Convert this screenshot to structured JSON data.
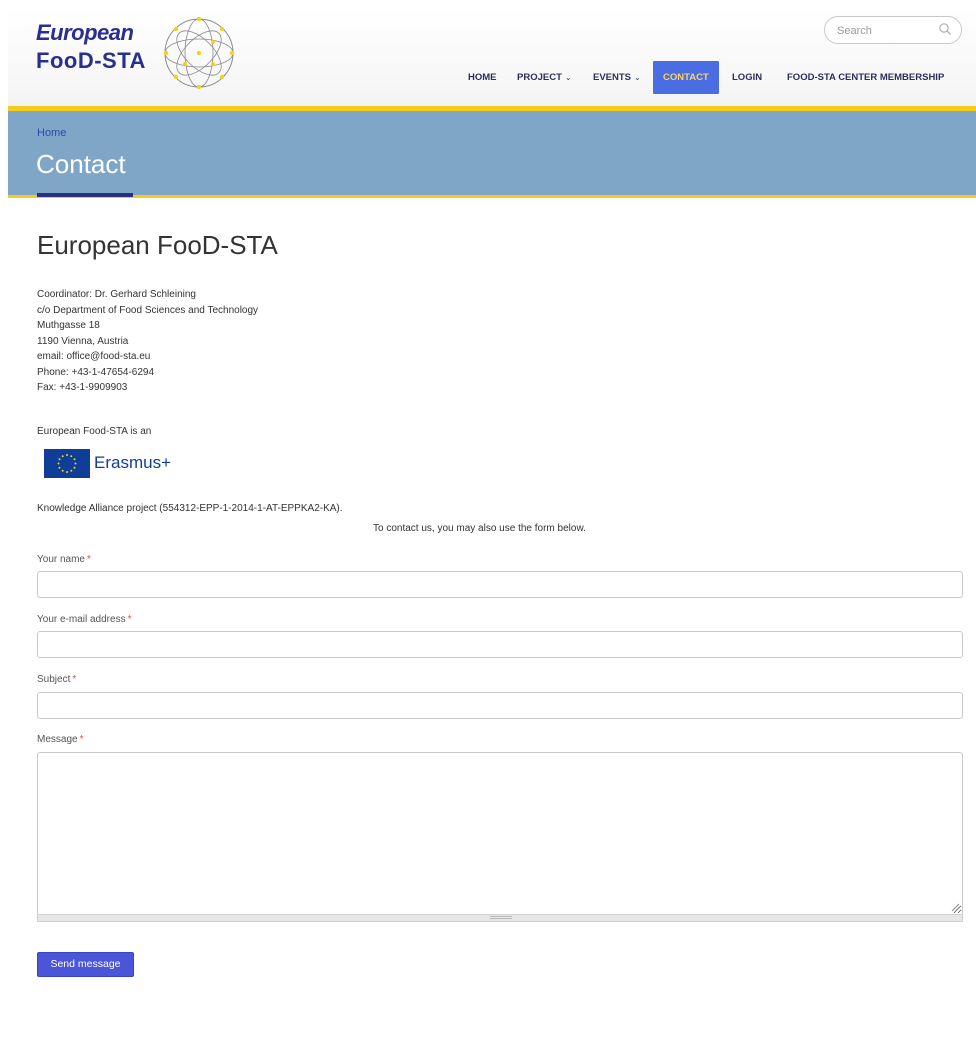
{
  "logo": {
    "line1": "European",
    "line2": "FooD-STA"
  },
  "search": {
    "placeholder": "Search"
  },
  "nav": {
    "items": [
      {
        "label": "HOME",
        "dropdown": false,
        "active": false
      },
      {
        "label": "PROJECT",
        "dropdown": true,
        "active": false
      },
      {
        "label": "EVENTS",
        "dropdown": true,
        "active": false
      },
      {
        "label": "CONTACT",
        "dropdown": false,
        "active": true
      },
      {
        "label": "LOGIN",
        "dropdown": false,
        "active": false
      },
      {
        "label": "FOOD-STA CENTER MEMBERSHIP",
        "dropdown": false,
        "active": false
      }
    ]
  },
  "banner": {
    "breadcrumb": "Home",
    "title": "Contact"
  },
  "main": {
    "heading": "European FooD-STA",
    "address": [
      "Coordinator: Dr. Gerhard Schleining",
      "c/o Department of Food Sciences and Technology",
      "Muthgasse 18",
      "1190 Vienna, Austria",
      "email: office@food-sta.eu",
      "Phone: +43-1-47654-6294",
      "Fax: +43-1-9909903"
    ],
    "is_an": "European Food-STA is an",
    "erasmus_label": "Erasmus+",
    "ka_text": "Knowledge Alliance project (554312-EPP-1-2014-1-AT-EPPKA2-KA).",
    "contact_note": "To contact us, you may also use the form below."
  },
  "form": {
    "name_label": "Your name",
    "email_label": "Your e-mail address",
    "subject_label": "Subject",
    "message_label": "Message",
    "required_mark": "*",
    "name_value": "",
    "email_value": "",
    "subject_value": "",
    "message_value": "",
    "submit_label": "Send message"
  },
  "colors": {
    "accent_yellow": "#f5cb1a",
    "banner_blue": "#7fa6c7",
    "nav_active": "#4a6de3",
    "button_blue": "#4a55d8",
    "brand_navy": "#2a2f8f"
  }
}
